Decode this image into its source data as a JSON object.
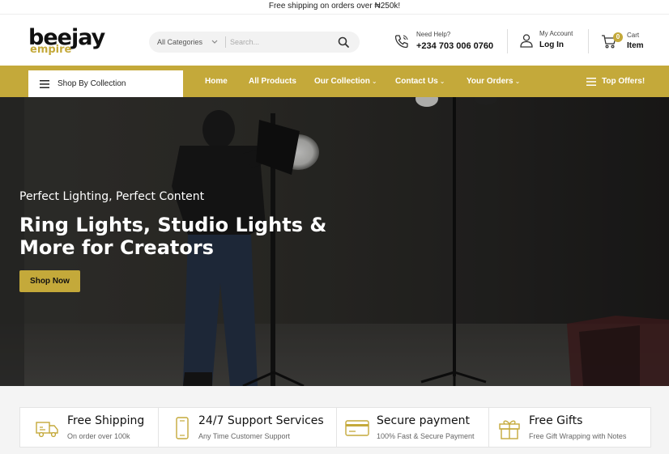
{
  "announcement": "Free shipping on orders over ₦250k!",
  "logo": {
    "main": "beejay",
    "sub": "empire"
  },
  "search": {
    "category": "All Categories",
    "placeholder": "Search..."
  },
  "help": {
    "label": "Need Help?",
    "phone": "+234 703 006 0760"
  },
  "account": {
    "label": "My Account",
    "action": "Log In"
  },
  "cart": {
    "count": "0",
    "label": "Cart",
    "item": "Item"
  },
  "nav": {
    "shop_by": "Shop By Collection",
    "links": [
      "Home",
      "All Products",
      "Our Collection",
      "Contact Us",
      "Your Orders"
    ],
    "top_offers": "Top Offers!"
  },
  "hero": {
    "subtitle": "Perfect Lighting, Perfect Content",
    "title": "Ring Lights, Studio Lights & More for Creators",
    "button": "Shop Now"
  },
  "features": [
    {
      "title": "Free Shipping",
      "desc": "On order over 100k",
      "icon": "truck-icon"
    },
    {
      "title": "24/7 Support Services",
      "desc": "Any Time Customer Support",
      "icon": "phone-icon"
    },
    {
      "title": "Secure payment",
      "desc": "100% Fast & Secure Payment",
      "icon": "card-icon"
    },
    {
      "title": "Free Gifts",
      "desc": "Free Gift Wrapping with Notes",
      "icon": "gift-icon"
    }
  ],
  "colors": {
    "accent": "#c4a93a",
    "hero_bg": "#2f2e2c"
  }
}
